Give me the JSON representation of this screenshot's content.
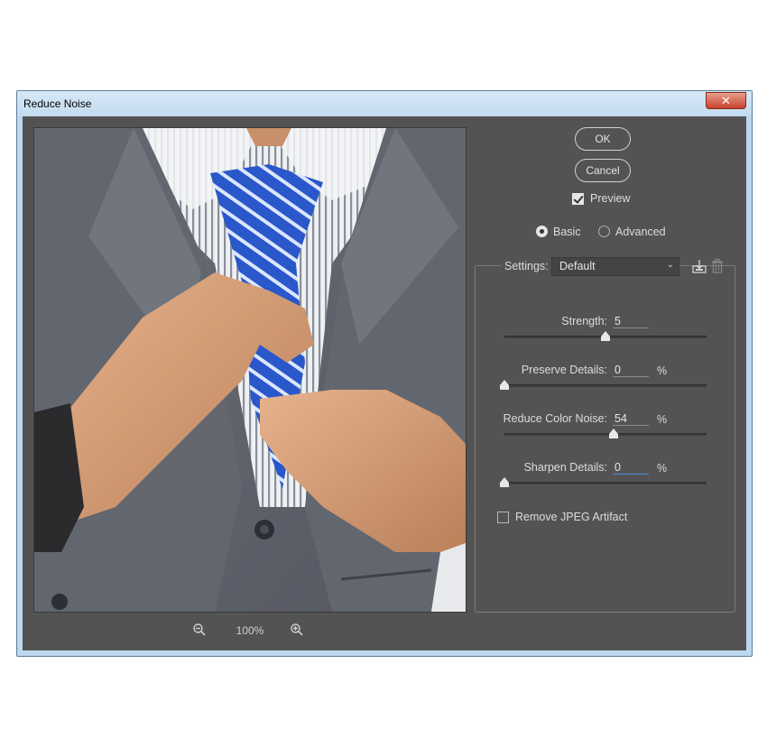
{
  "window": {
    "title": "Reduce Noise",
    "close_glyph": "✕"
  },
  "preview": {
    "zoom_level": "100%"
  },
  "buttons": {
    "ok": "OK",
    "cancel": "Cancel"
  },
  "preview_toggle": {
    "label": "Preview",
    "checked": true
  },
  "mode": {
    "basic": "Basic",
    "advanced": "Advanced",
    "selected": "basic"
  },
  "settings": {
    "label": "Settings:",
    "selected": "Default"
  },
  "sliders": [
    {
      "label": "Strength:",
      "value": "5",
      "show_pct": false,
      "fraction": 0.5
    },
    {
      "label": "Preserve Details:",
      "value": "0",
      "show_pct": true,
      "pct": "%",
      "fraction": 0.0
    },
    {
      "label": "Reduce Color Noise:",
      "value": "54",
      "show_pct": true,
      "pct": "%",
      "fraction": 0.54
    },
    {
      "label": "Sharpen Details:",
      "value": "0",
      "show_pct": true,
      "pct": "%",
      "fraction": 0.0
    }
  ],
  "jpeg_artifact": {
    "label": "Remove JPEG Artifact",
    "checked": false
  },
  "icons": {
    "zoom_out": "zoom-out-icon",
    "zoom_in": "zoom-in-icon",
    "save_settings": "save-settings-icon",
    "delete_settings": "trash-icon"
  }
}
